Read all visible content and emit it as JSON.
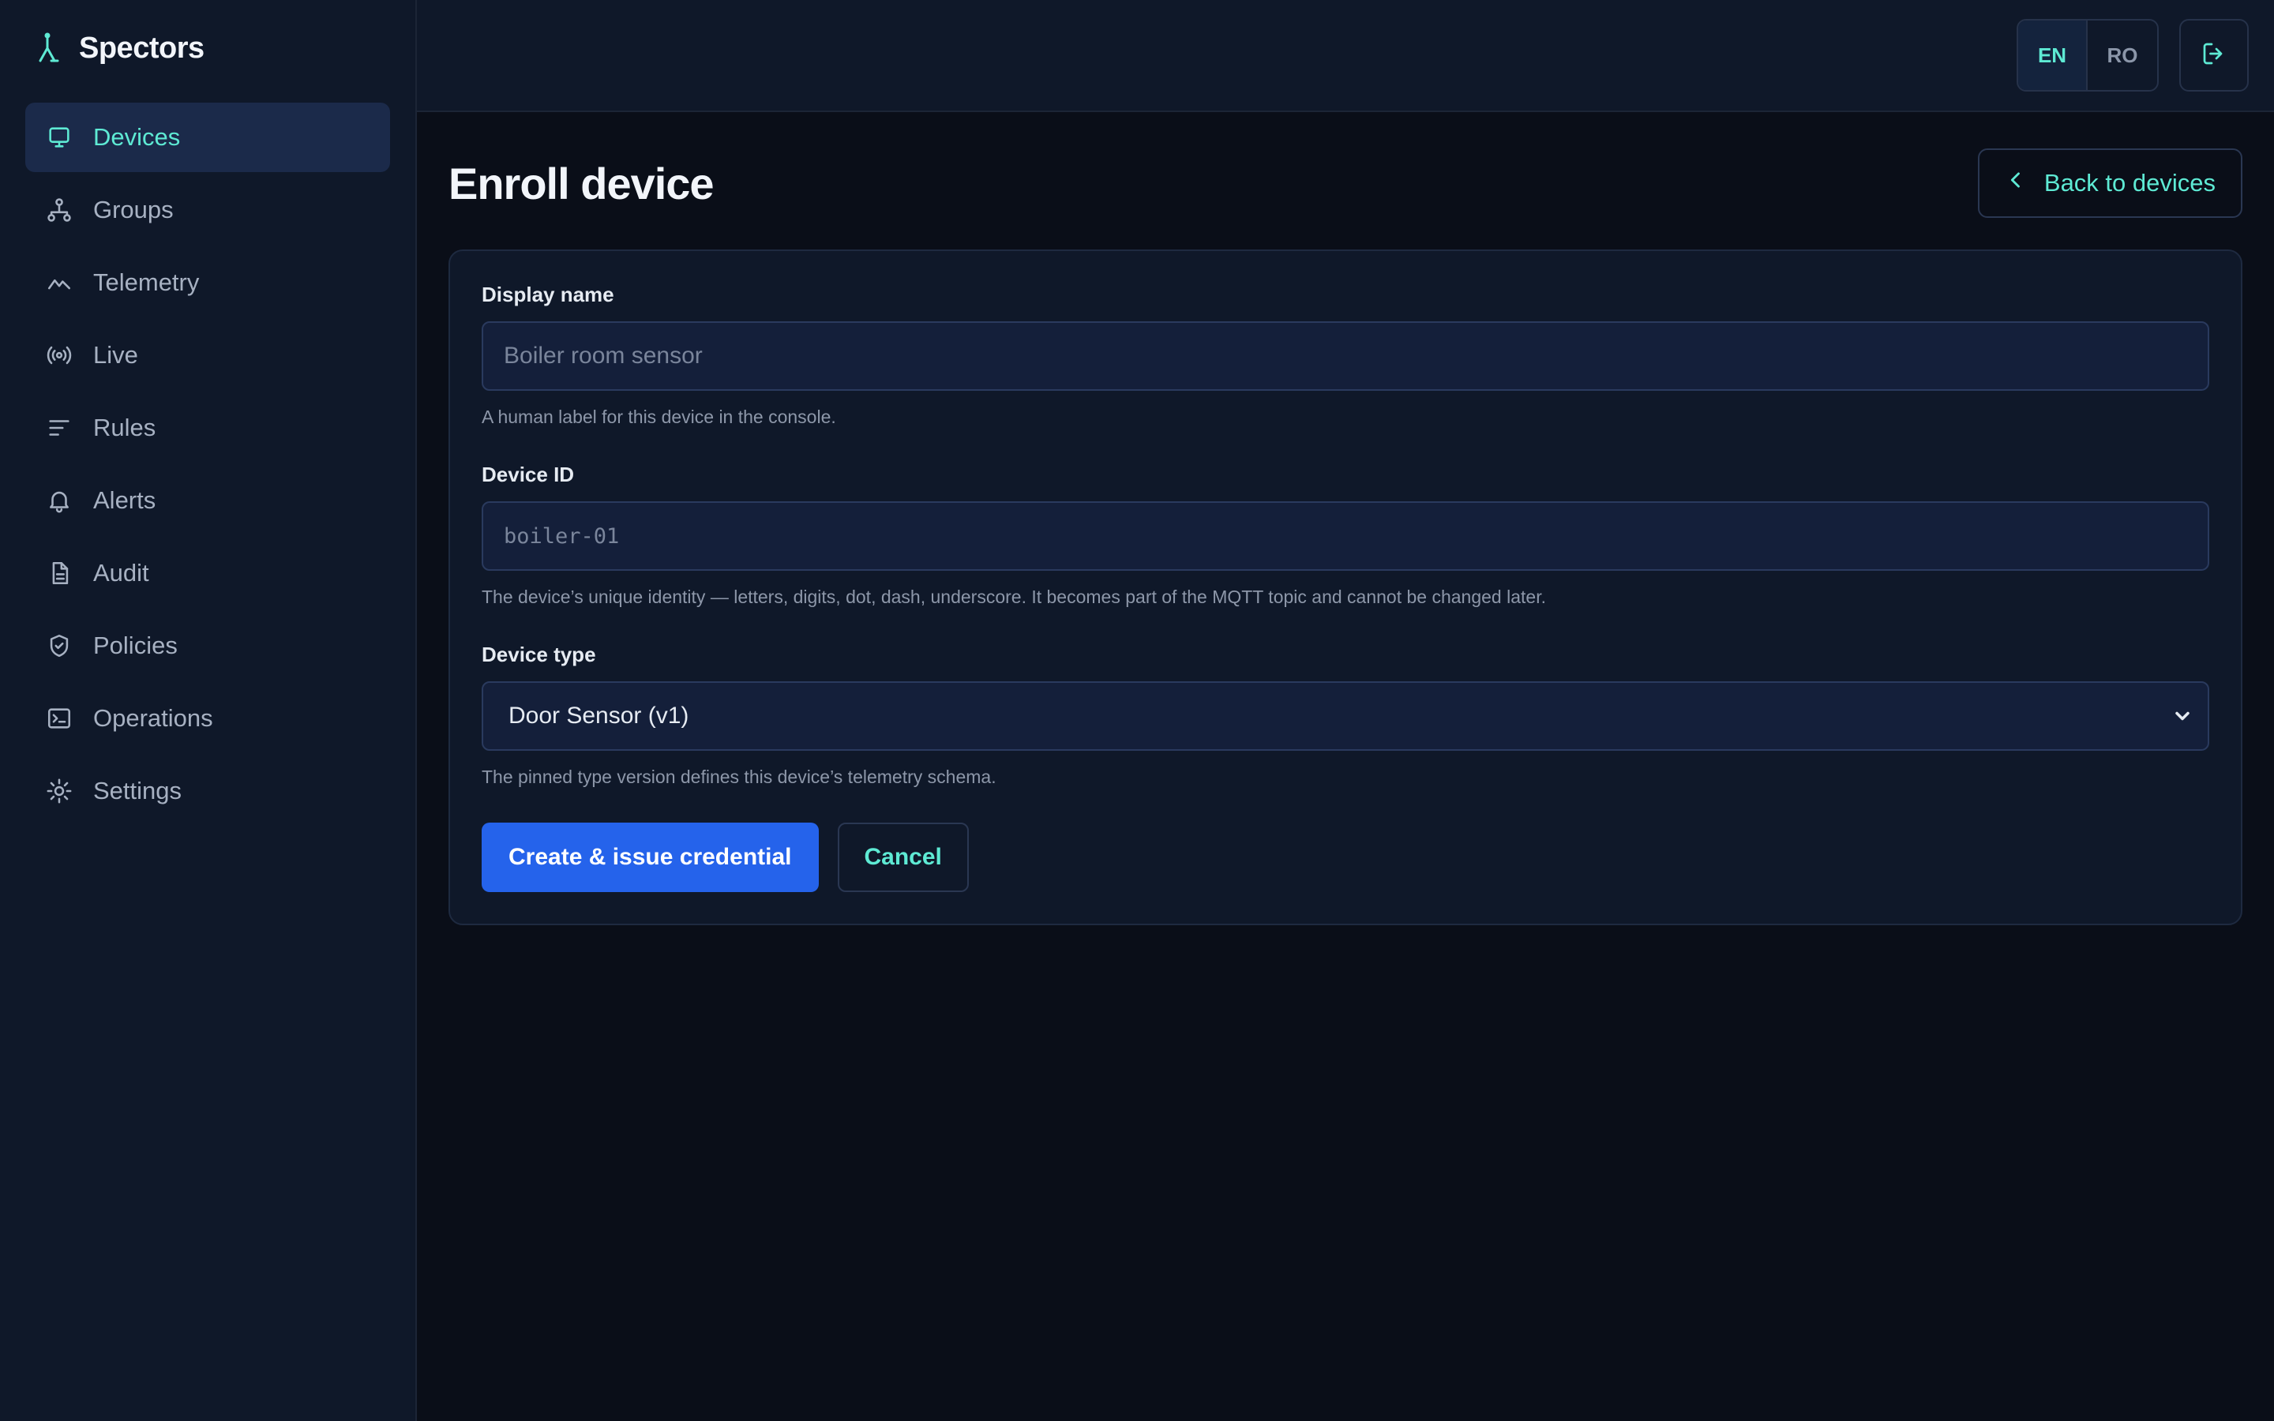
{
  "brand": {
    "name": "Spectors",
    "icon": "lambda-icon"
  },
  "sidebar": {
    "items": [
      {
        "label": "Devices",
        "icon": "monitor-icon",
        "active": true
      },
      {
        "label": "Groups",
        "icon": "hierarchy-icon"
      },
      {
        "label": "Telemetry",
        "icon": "chart-line-icon"
      },
      {
        "label": "Live",
        "icon": "broadcast-icon"
      },
      {
        "label": "Rules",
        "icon": "filter-lines-icon"
      },
      {
        "label": "Alerts",
        "icon": "bell-icon"
      },
      {
        "label": "Audit",
        "icon": "document-icon"
      },
      {
        "label": "Policies",
        "icon": "shield-check-icon"
      },
      {
        "label": "Operations",
        "icon": "terminal-icon"
      },
      {
        "label": "Settings",
        "icon": "gear-icon"
      }
    ]
  },
  "topbar": {
    "languages": [
      {
        "code": "EN",
        "active": true
      },
      {
        "code": "RO",
        "active": false
      }
    ],
    "logout_icon": "logout-icon"
  },
  "page": {
    "title": "Enroll device",
    "back_label": "Back to devices"
  },
  "form": {
    "display_name": {
      "label": "Display name",
      "placeholder": "Boiler room sensor",
      "value": "",
      "hint": "A human label for this device in the console."
    },
    "device_id": {
      "label": "Device ID",
      "placeholder": "boiler-01",
      "value": "",
      "hint": "The device’s unique identity — letters, digits, dot, dash, underscore. It becomes part of the MQTT topic and cannot be changed later."
    },
    "device_type": {
      "label": "Device type",
      "selected": "Door Sensor (v1)",
      "hint": "The pinned type version defines this device’s telemetry schema."
    },
    "submit_label": "Create & issue credential",
    "cancel_label": "Cancel"
  },
  "colors": {
    "accent": "#5eead4",
    "primary": "#2563eb",
    "sidebar_bg": "#0f1829",
    "page_bg": "#0a0e18"
  }
}
